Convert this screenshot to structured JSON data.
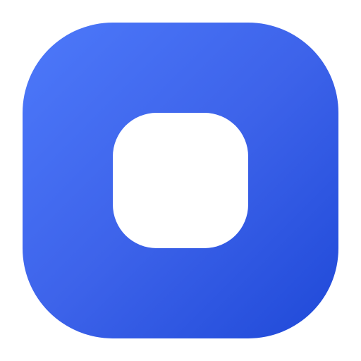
{
  "icon": {
    "name": "stop-icon",
    "background_gradient": [
      "#4d79fa",
      "#3d63ea",
      "#1f49d8"
    ],
    "glyph_color": "#ffffff"
  },
  "page": {
    "background": "#ffffff"
  }
}
